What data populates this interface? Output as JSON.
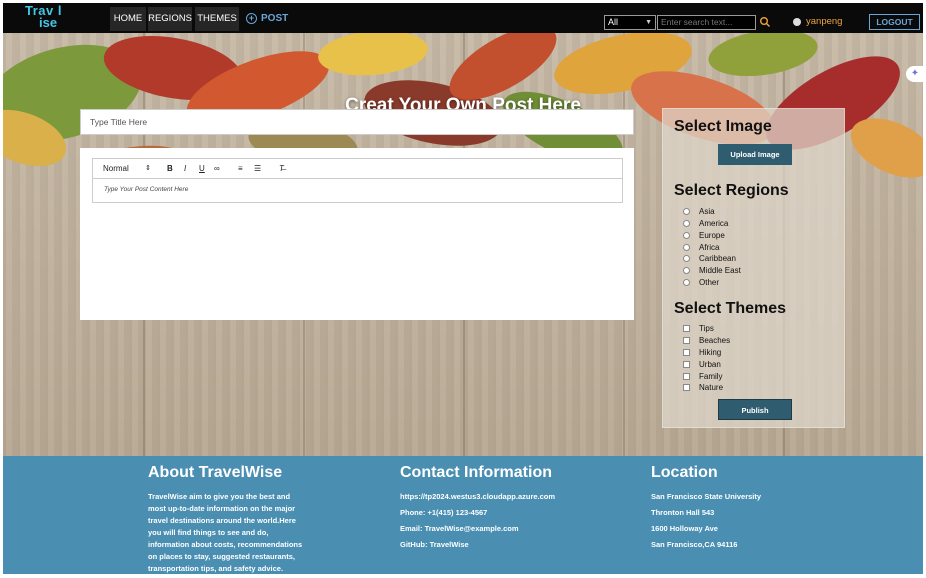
{
  "nav": {
    "logo_line1": "Trav l",
    "logo_line2": "ise",
    "items": [
      "HOME",
      "REGIONS",
      "THEMES"
    ],
    "post_label": "POST",
    "search_scope": "All",
    "search_placeholder": "Enter search text...",
    "username": "yanpeng",
    "logout_label": "LOGOUT"
  },
  "hero": {
    "title": "Creat Your Own Post Here"
  },
  "form": {
    "title_placeholder": "Type Title Here",
    "toolbar_format": "Normal",
    "content_placeholder": "Type Your Post Content Here"
  },
  "sidebar": {
    "image_heading": "Select Image",
    "upload_label": "Upload Image",
    "regions_heading": "Select Regions",
    "regions": [
      "Asia",
      "America",
      "Europe",
      "Africa",
      "Caribbean",
      "Middle East",
      "Other"
    ],
    "themes_heading": "Select Themes",
    "themes": [
      "Tips",
      "Beaches",
      "Hiking",
      "Urban",
      "Family",
      "Nature"
    ],
    "publish_label": "Publish"
  },
  "footer": {
    "about": {
      "heading": "About TravelWise",
      "lines": [
        "TravelWise aim to give you the best and",
        "most up-to-date information on the major",
        "travel destinations around the world.Here",
        "you will find things to see and do,",
        "information about costs, recommendations",
        "on places to stay, suggested restaurants,",
        "transportation tips, and safety advice."
      ]
    },
    "contact": {
      "heading": "Contact Information",
      "url": "https://tp2024.westus3.cloudapp.azure.com",
      "phone": "Phone: +1(415) 123-4567",
      "email": "Email: TravelWise@example.com",
      "github": "GitHub: TravelWise"
    },
    "location": {
      "heading": "Location",
      "line1": "San Francisco State University",
      "line2": "Thronton Hall 543",
      "line3": "1600 Holloway Ave",
      "line4": "San Francisco,CA 94116"
    }
  },
  "colors": {
    "nav_bg": "#0a0a0a",
    "accent": "#45c7e6",
    "button": "#2f5d6f",
    "footer_bg": "#4a8eb2",
    "username": "#f0a43a"
  }
}
